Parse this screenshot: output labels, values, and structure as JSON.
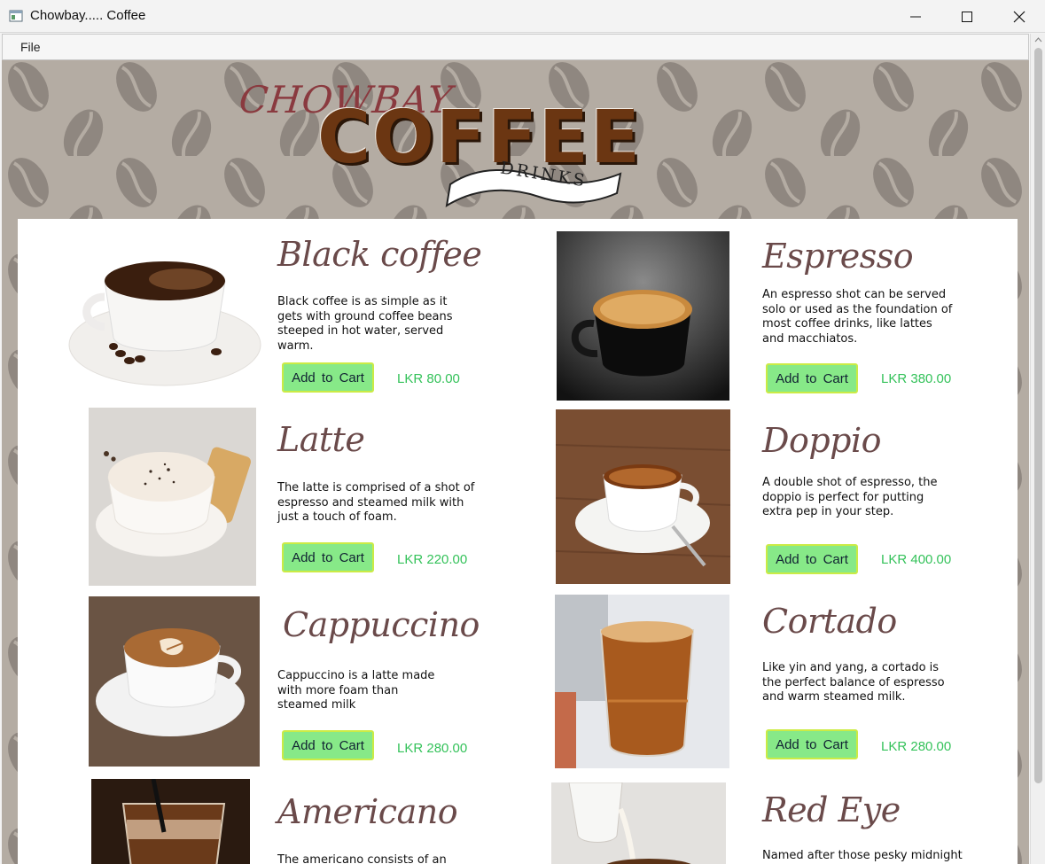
{
  "window": {
    "title": "Chowbay..... Coffee",
    "controls": {
      "minimize": "minimize-icon",
      "maximize": "maximize-icon",
      "close": "close-icon"
    }
  },
  "menu": {
    "file": "File"
  },
  "logo": {
    "brand": "CHOWBAY",
    "word": "COFFEE",
    "banner": "DRINKS"
  },
  "colors": {
    "background": "#b4aca3",
    "bean": "#8f8780",
    "title_text": "#6a4a4a",
    "button_fill": "#87e988",
    "button_border": "#cbeb45",
    "price_text": "#34c25a"
  },
  "products": [
    {
      "name": "Black coffee",
      "description": "Black coffee is as simple as it gets with ground coffee beans steeped in hot water, served warm.",
      "button": "Add  to Cart",
      "price": "LKR 80.00"
    },
    {
      "name": "Espresso",
      "description": "An espresso shot can be served solo or used as the foundation of most coffee drinks, like lattes and macchiatos.",
      "button": "Add  to Cart",
      "price": "LKR 380.00"
    },
    {
      "name": "Latte",
      "description": "The latte is comprised of a shot of espresso and steamed milk with just a touch of foam.",
      "button": "Add  to Cart",
      "price": "LKR 220.00"
    },
    {
      "name": "Doppio",
      "description": "A double shot of espresso, the doppio is perfect for putting extra pep in your step.",
      "button": "Add  to Cart",
      "price": "LKR 400.00"
    },
    {
      "name": "Cappuccino",
      "description": "Cappuccino is a latte made with more foam than steamed milk",
      "button": "Add  to Cart",
      "price": "LKR 280.00"
    },
    {
      "name": "Cortado",
      "description": "Like yin and yang, a cortado is the perfect balance of espresso and warm steamed milk.",
      "button": "Add  to Cart",
      "price": "LKR 280.00"
    },
    {
      "name": "Americano",
      "description": "The americano consists of an",
      "button": "",
      "price": ""
    },
    {
      "name": "Red Eye",
      "description": "Named after those pesky midnight",
      "button": "",
      "price": ""
    }
  ]
}
